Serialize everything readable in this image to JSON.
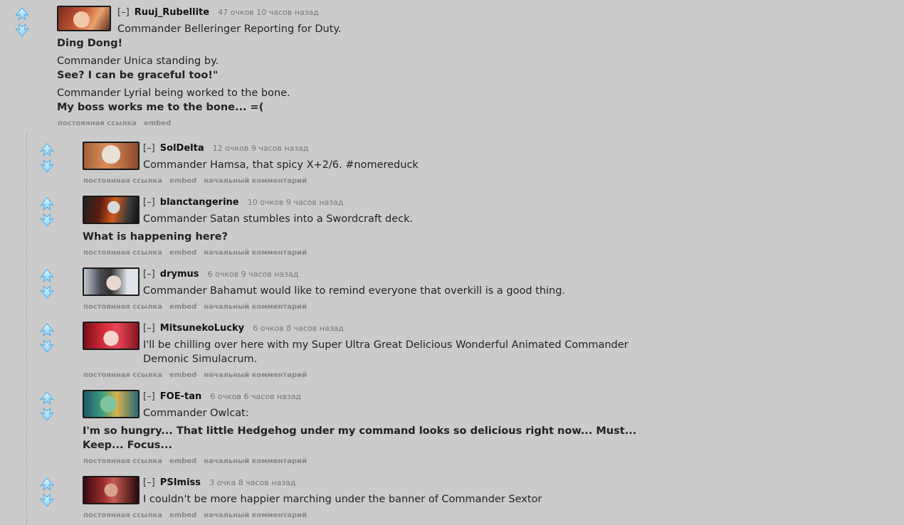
{
  "ui": {
    "permalink": "постоянная ссылка",
    "embed": "embed",
    "parent": "начальный комментарий",
    "collapse": "[–]"
  },
  "comments": [
    {
      "author": "Ruuj_Rubellite",
      "meta": "47 очков 10 часов назад",
      "lines": [
        "Commander Belleringer Reporting for Duty.",
        "Ding Dong!",
        "Commander Unica standing by.",
        "See? I can be graceful too!\"",
        "Commander Lyrial being worked to the bone.",
        "My boss works me to the bone... =("
      ]
    },
    {
      "author": "SolDelta",
      "meta": "12 очков 9 часов назад",
      "lines": [
        "Commander Hamsa, that spicy X+2/6. #nomereduck"
      ]
    },
    {
      "author": "blanctangerine",
      "meta": "10 очков 9 часов назад",
      "lines": [
        "Commander Satan stumbles into a Swordcraft deck.",
        "What is happening here?"
      ]
    },
    {
      "author": "drymus",
      "meta": "6 очков 9 часов назад",
      "lines": [
        "Commander Bahamut would like to remind everyone that overkill is a good thing."
      ]
    },
    {
      "author": "MitsunekoLucky",
      "meta": "6 очков 8 часов назад",
      "lines": [
        "I'll be chilling over here with my Super Ultra Great Delicious Wonderful Animated Commander Demonic Simulacrum."
      ]
    },
    {
      "author": "FOE-tan",
      "meta": "6 очков 6 часов назад",
      "lines": [
        "Commander Owlcat:",
        "I'm so hungry... That little Hedgehog under my command looks so delicious right now... Must... Keep... Focus..."
      ]
    },
    {
      "author": "PSImiss",
      "meta": "3 очка 8 часов назад",
      "lines": [
        "I couldn't be more happier marching under the banner of Commander Sextor"
      ]
    }
  ]
}
